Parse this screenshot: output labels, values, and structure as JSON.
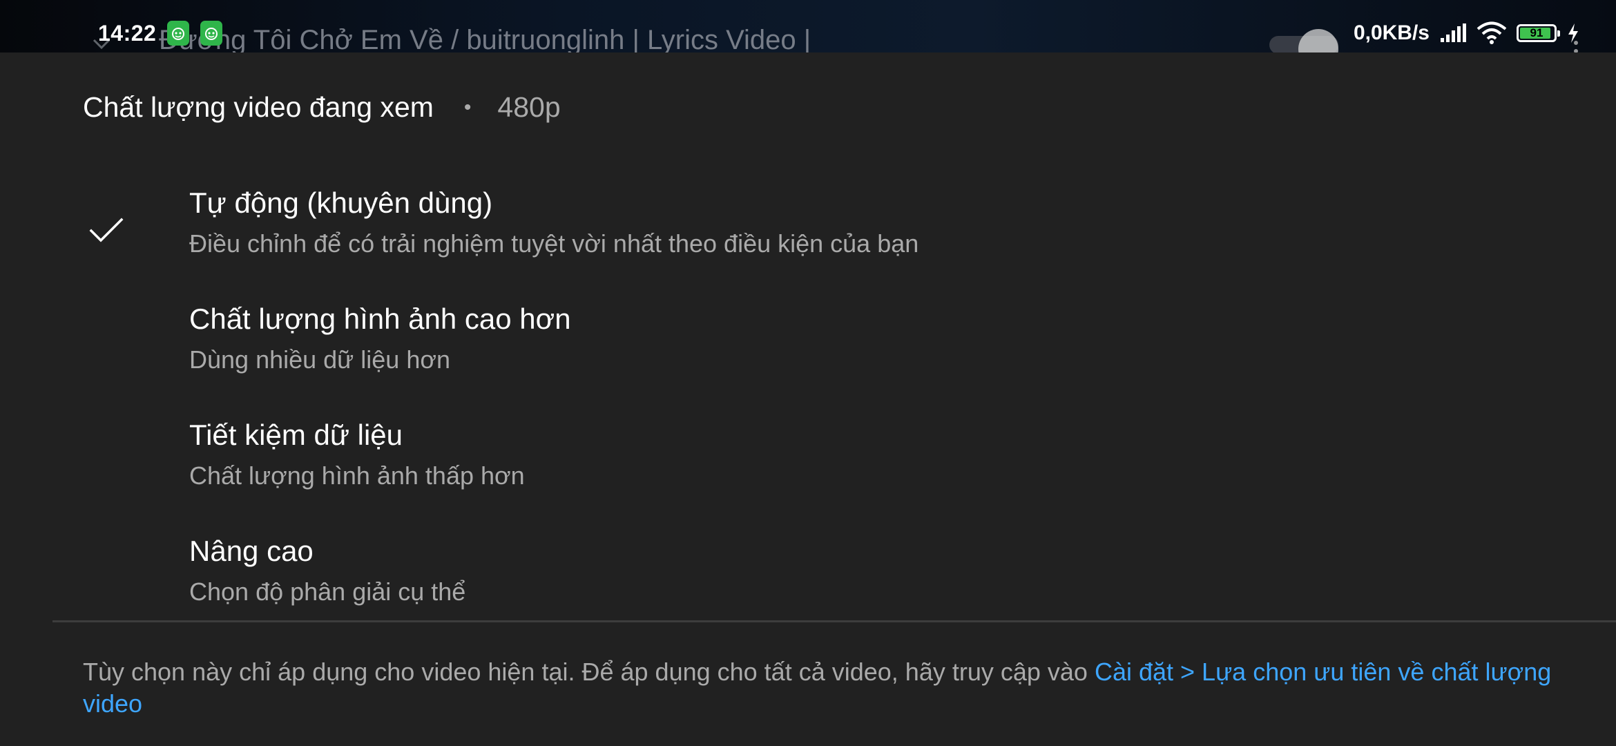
{
  "status_bar": {
    "time": "14:22",
    "net_speed": "0,0KB/s",
    "battery_level": "91",
    "battery_percent": 91,
    "icons": [
      "notification-app-icon",
      "notification-app-icon",
      "signal-icon",
      "wifi-icon",
      "battery-icon",
      "charging-icon"
    ]
  },
  "background": {
    "video_title": "Đường Tôi Chở Em Về / buitruonglinh | Lyrics Video |"
  },
  "sheet": {
    "title": "Chất lượng video đang xem",
    "separator": "•",
    "current_quality": "480p",
    "options": [
      {
        "title": "Tự động (khuyên dùng)",
        "description": "Điều chỉnh để có trải nghiệm tuyệt vời nhất theo điều kiện của bạn",
        "selected": true
      },
      {
        "title": "Chất lượng hình ảnh cao hơn",
        "description": "Dùng nhiều dữ liệu hơn",
        "selected": false
      },
      {
        "title": "Tiết kiệm dữ liệu",
        "description": "Chất lượng hình ảnh thấp hơn",
        "selected": false
      },
      {
        "title": "Nâng cao",
        "description": "Chọn độ phân giải cụ thể",
        "selected": false
      }
    ],
    "footer_text": "Tùy chọn này chỉ áp dụng cho video hiện tại. Để áp dụng cho tất cả video, hãy truy cập vào ",
    "footer_link": "Cài đặt > Lựa chọn ưu tiên về chất lượng video"
  },
  "colors": {
    "sheet_bg": "#212121",
    "primary_text": "#ffffff",
    "secondary_text": "#aaaaaa",
    "link": "#3ea6ff",
    "battery_fill": "#3fc24f"
  }
}
